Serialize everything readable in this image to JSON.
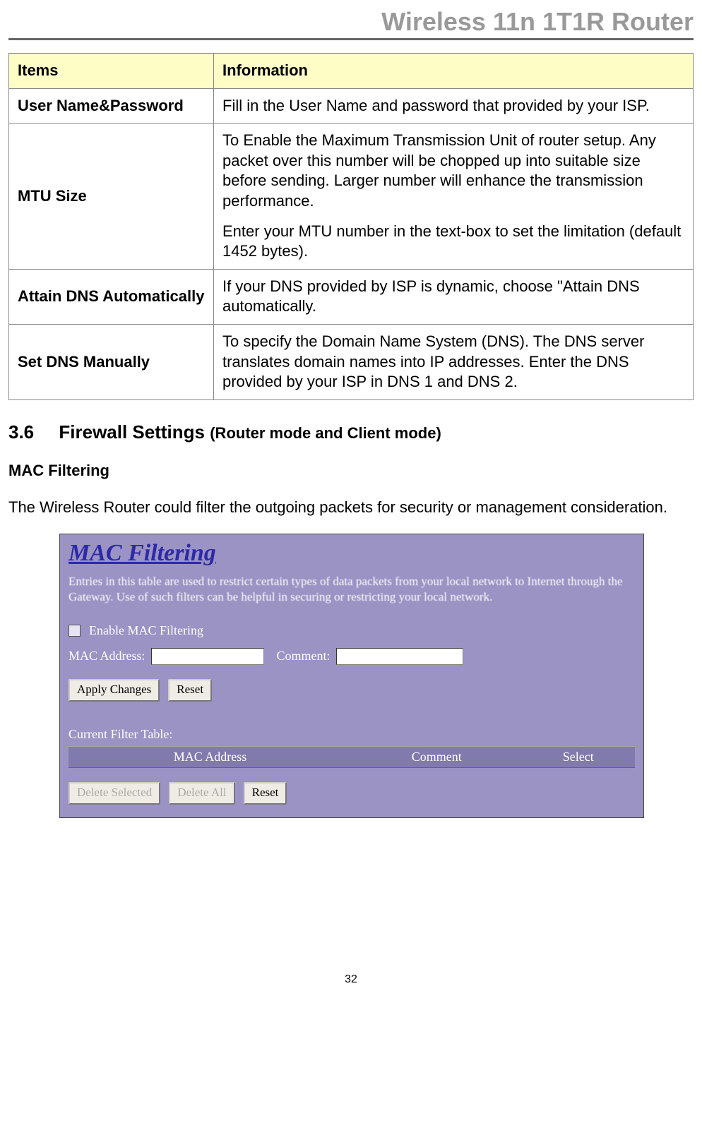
{
  "header": "Wireless 11n 1T1R Router",
  "table": {
    "head_items": "Items",
    "head_info": "Information",
    "rows": [
      {
        "item": "User Name&Password",
        "info": "Fill in the User Name and password that provided by your ISP."
      },
      {
        "item": "MTU Size",
        "info_p1": "To Enable the Maximum Transmission Unit of router setup. Any packet over this number will be chopped up into suitable size before sending. Larger number will enhance the transmission performance.",
        "info_p2": "Enter your MTU number in the text-box to set the limitation (default 1452 bytes)."
      },
      {
        "item": "Attain DNS Automatically",
        "info": "If your DNS provided by ISP is dynamic, choose \"Attain DNS automatically."
      },
      {
        "item": "Set DNS Manually",
        "info": "To specify the Domain Name System (DNS). The DNS server translates domain names into IP addresses. Enter the DNS provided by your ISP in DNS 1 and DNS 2."
      }
    ]
  },
  "section": {
    "number": "3.6",
    "title": "Firewall Settings",
    "subtitle": "(Router mode and Client mode)"
  },
  "subheading": "MAC Filtering",
  "bodytext": "The Wireless Router could filter the outgoing packets for security or management consideration.",
  "panel": {
    "title": "MAC Filtering",
    "desc": "Entries in this table are used to restrict certain types of data packets from your local network to Internet through the Gateway. Use of such filters can be helpful in securing or restricting your local network.",
    "enable_label": "Enable MAC Filtering",
    "mac_label": "MAC Address:",
    "comment_label": "Comment:",
    "apply_btn": "Apply Changes",
    "reset_btn": "Reset",
    "filter_table_label": "Current Filter Table:",
    "col_mac": "MAC Address",
    "col_comment": "Comment",
    "col_select": "Select",
    "del_selected": "Delete Selected",
    "del_all": "Delete All",
    "reset2": "Reset"
  },
  "page": "32"
}
